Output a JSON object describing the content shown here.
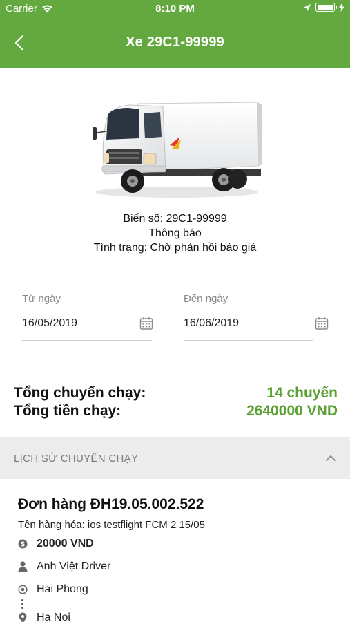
{
  "status_bar": {
    "carrier": "Carrier",
    "time": "8:10 PM",
    "battery_level": 1.0,
    "icons": [
      "wifi-icon",
      "location-arrow-icon",
      "battery-icon",
      "charging-bolt-icon"
    ]
  },
  "nav": {
    "title": "Xe 29C1-99999",
    "back_icon": "chevron-left-icon"
  },
  "vehicle": {
    "image": "truck-image",
    "plate_line": "Biển số: 29C1-99999",
    "notice_line": "Thông báo",
    "status_line": "Tình trạng: Chờ phản hồi báo giá"
  },
  "date_filter": {
    "from_label": "Từ ngày",
    "from_value": "16/05/2019",
    "to_label": "Đến ngày",
    "to_value": "16/06/2019",
    "icon": "calendar-icon"
  },
  "totals": {
    "trips_label": "Tổng chuyến chạy:",
    "trips_value": "14 chuyến",
    "amount_label": "Tổng tiền chạy:",
    "amount_value": "2640000 VND"
  },
  "history": {
    "title": "LỊCH SỬ CHUYẾN CHẠY",
    "toggle_icon": "chevron-up-icon"
  },
  "order": {
    "title": "Đơn hàng ĐH19.05.002.522",
    "goods": "Tên hàng hóa: ios testflight FCM 2 15/05",
    "price": "20000 VND",
    "driver": "Anh Việt Driver",
    "origin": "Hai Phong",
    "destination": "Ha Noi"
  },
  "colors": {
    "brand_green": "#63a93f",
    "value_green": "#5aa033",
    "section_grey": "#ececec"
  }
}
